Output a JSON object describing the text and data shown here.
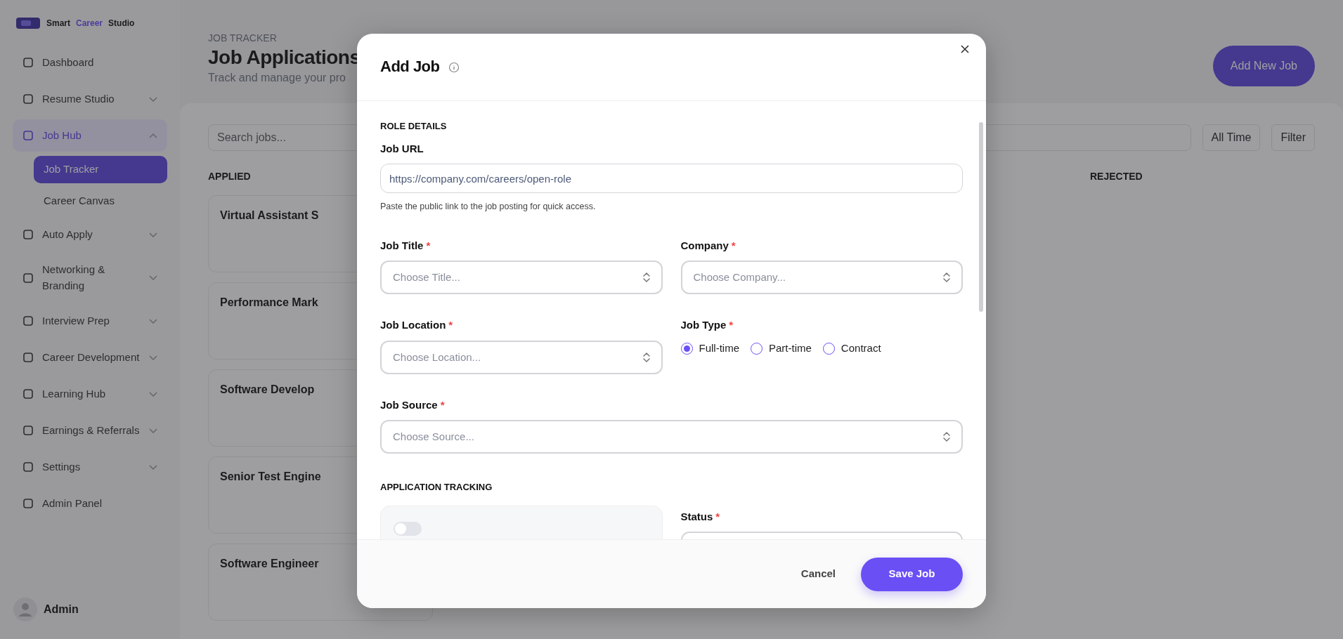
{
  "sidebar": {
    "brand": [
      "Smart",
      "Career",
      "Studio"
    ],
    "items": [
      {
        "label": "Dashboard",
        "kind": "link",
        "selected": false,
        "expanded": false
      },
      {
        "label": "Resume Studio",
        "kind": "group",
        "selected": false,
        "expanded": false
      },
      {
        "label": "Job Hub",
        "kind": "group",
        "selected": true,
        "expanded": true,
        "children": [
          {
            "label": "Job Tracker",
            "selected": true
          },
          {
            "label": "Career Canvas",
            "selected": false
          }
        ]
      },
      {
        "label": "Auto Apply",
        "kind": "group",
        "selected": false,
        "expanded": false
      },
      {
        "label": "Networking & Branding",
        "kind": "group",
        "selected": false,
        "expanded": false
      },
      {
        "label": "Interview Prep",
        "kind": "group",
        "selected": false,
        "expanded": false
      },
      {
        "label": "Career Development",
        "kind": "group",
        "selected": false,
        "expanded": false
      },
      {
        "label": "Learning Hub",
        "kind": "group",
        "selected": false,
        "expanded": false
      },
      {
        "label": "Earnings & Referrals",
        "kind": "group",
        "selected": false,
        "expanded": false
      },
      {
        "label": "Settings",
        "kind": "group",
        "selected": false,
        "expanded": false
      },
      {
        "label": "Admin Panel",
        "kind": "link",
        "selected": false,
        "expanded": false
      }
    ],
    "user": {
      "name": "Admin"
    }
  },
  "page": {
    "breadcrumb": "JOB TRACKER",
    "title": "Job Applications",
    "subtitle": "Track and manage your pro",
    "add_button": "Add New Job",
    "search": {
      "placeholder": "Search jobs..."
    },
    "time_filter": "All Time",
    "filter": "Filter",
    "columns": [
      {
        "title": "APPLIED",
        "cards": [
          {
            "title": "Virtual Assistant S"
          },
          {
            "title": "Performance Mark"
          },
          {
            "title": "Software Develop"
          },
          {
            "title": "Senior Test Engine"
          },
          {
            "title": "Software Engineer"
          }
        ]
      },
      {
        "title": "REJECTED"
      }
    ]
  },
  "modal": {
    "title": "Add Job",
    "section_1": "ROLE DETAILS",
    "job_url": {
      "label": "Job URL",
      "value": "https://company.com/careers/open-role",
      "help": "Paste the public link to the job posting for quick access."
    },
    "job_title": {
      "label": "Job Title",
      "required_mark": "*",
      "placeholder": "Choose Title..."
    },
    "company": {
      "label": "Company",
      "required_mark": "*",
      "placeholder": "Choose Company..."
    },
    "job_location": {
      "label": "Job Location",
      "required_mark": "*",
      "placeholder": "Choose Location..."
    },
    "job_type": {
      "label": "Job Type",
      "required_mark": "*",
      "options": [
        {
          "label": "Full-time",
          "selected": true
        },
        {
          "label": "Part-time",
          "selected": false
        },
        {
          "label": "Contract",
          "selected": false
        }
      ]
    },
    "job_source": {
      "label": "Job Source",
      "required_mark": "*",
      "placeholder": "Choose Source..."
    },
    "section_2": "APPLICATION TRACKING",
    "tracking_toggle": {
      "on": false
    },
    "status": {
      "label": "Status",
      "required_mark": "*"
    },
    "buttons": {
      "cancel": "Cancel",
      "save": "Save Job"
    }
  }
}
